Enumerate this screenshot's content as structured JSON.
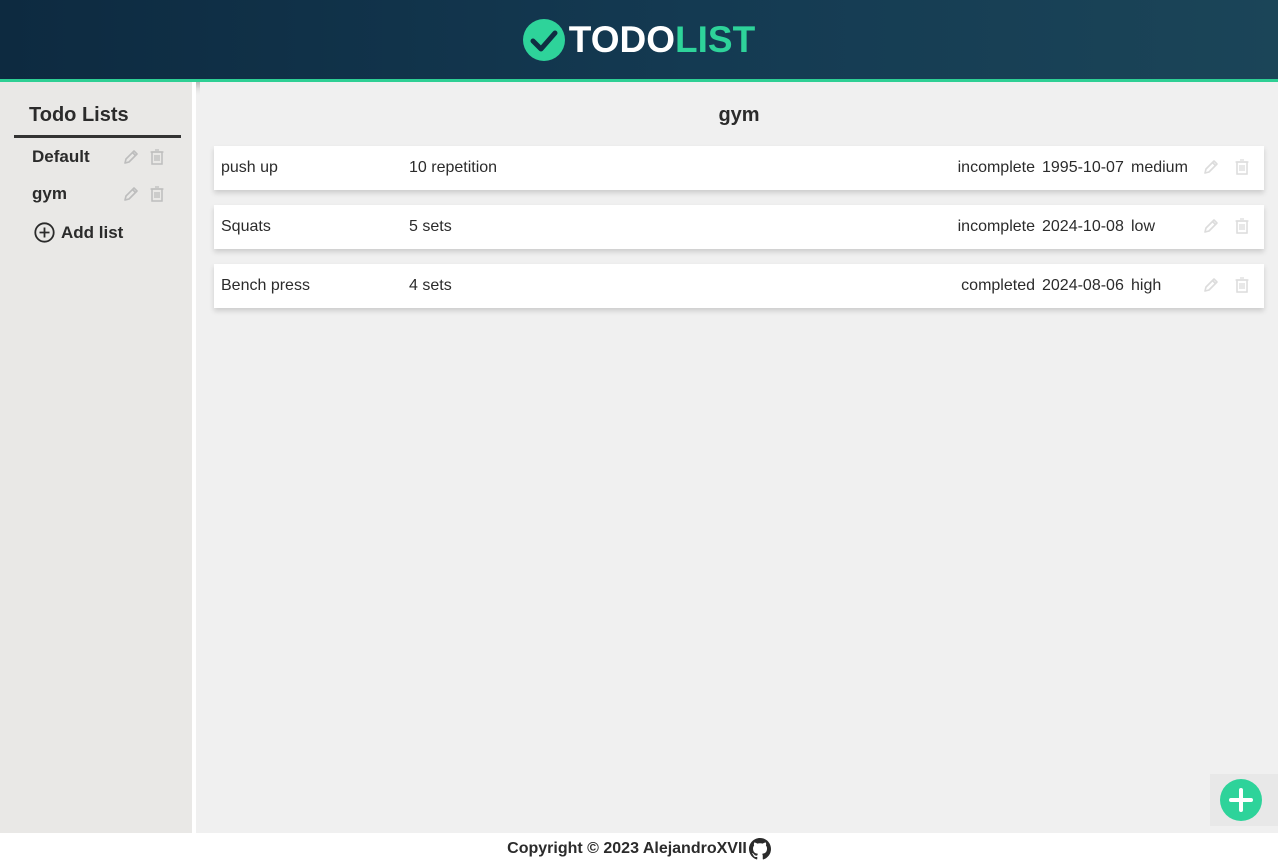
{
  "header": {
    "logo_todo": "TODO",
    "logo_list": "LIST",
    "accent_color": "#2ed39a"
  },
  "sidebar": {
    "title": "Todo Lists",
    "lists": [
      {
        "label": "Default"
      },
      {
        "label": "gym"
      }
    ],
    "add_list_label": "Add list"
  },
  "main": {
    "list_title": "gym",
    "todos": [
      {
        "name": "push up",
        "description": "10 repetition",
        "status": "incomplete",
        "date": "1995-10-07",
        "priority": "medium"
      },
      {
        "name": "Squats",
        "description": "5 sets",
        "status": "incomplete",
        "date": "2024-10-08",
        "priority": "low"
      },
      {
        "name": "Bench press",
        "description": "4 sets",
        "status": "completed",
        "date": "2024-08-06",
        "priority": "high"
      }
    ]
  },
  "footer": {
    "copyright": "Copyright © 2023 AlejandroXVII"
  },
  "icons": {
    "logo": "check-circle-icon",
    "edit": "pencil-icon",
    "delete": "trash-icon",
    "add_list": "plus-circle-icon",
    "fab": "plus-icon",
    "github": "github-icon"
  }
}
